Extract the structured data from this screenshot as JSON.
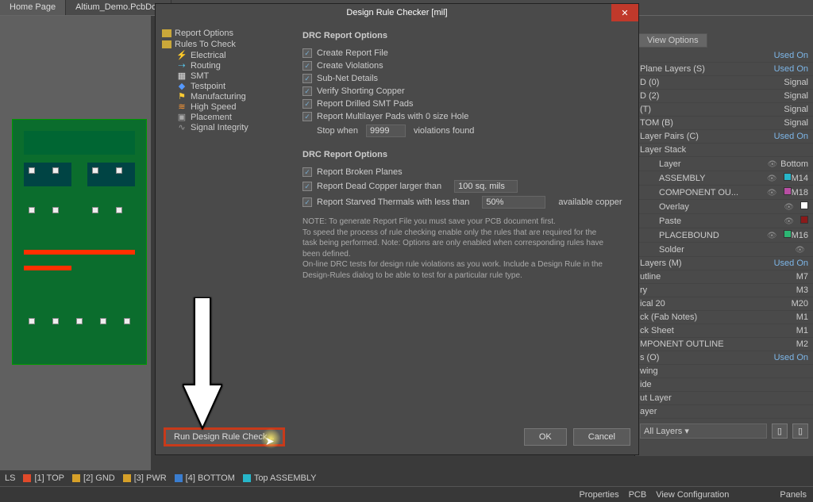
{
  "tabs": {
    "home": "Home Page",
    "doc": "Altium_Demo.PcbDoc"
  },
  "dialog": {
    "title": "Design Rule Checker [mil]",
    "tree": {
      "reportOptions": "Report Options",
      "rulesToCheck": "Rules To Check",
      "children": {
        "electrical": "Electrical",
        "routing": "Routing",
        "smt": "SMT",
        "testpoint": "Testpoint",
        "manufacturing": "Manufacturing",
        "highspeed": "High Speed",
        "placement": "Placement",
        "signalIntegrity": "Signal Integrity"
      }
    },
    "section1": "DRC Report Options",
    "opts": {
      "createReportFile": "Create Report File",
      "createViolations": "Create Violations",
      "subNetDetails": "Sub-Net Details",
      "verifyShortingCopper": "Verify Shorting Copper",
      "reportDrilledSMT": "Report Drilled SMT Pads",
      "reportMultilayer": "Report Multilayer Pads with 0 size Hole",
      "stopWhen": "Stop when",
      "stopValue": "9999",
      "violationsFound": "violations found"
    },
    "section2": "DRC Report Options",
    "opts2": {
      "reportBroken": "Report Broken Planes",
      "reportDead": "Report Dead Copper larger than",
      "deadValue": "100 sq. mils",
      "reportStarved": "Report Starved Thermals with less than",
      "starvedValue": "50%",
      "availableCopper": "available copper"
    },
    "note": "NOTE: To generate Report File you must save your PCB document first.\nTo speed the process of rule checking enable only the rules that are required for the task being performed.  Note: Options are only enabled when corresponding rules have been defined.\nOn-line DRC tests for design rule violations as you work. Include a Design Rule in the Design-Rules dialog to be able to test for a particular rule  type.",
    "runBtn": "Run Design Rule Check...",
    "ok": "OK",
    "cancel": "Cancel"
  },
  "rightPanel": {
    "viewOptions": "View Options",
    "usedOn": "Used On",
    "groups": {
      "planeLayers": "Plane Layers (S)",
      "d0": "D (0)",
      "d2": "D (2)",
      "t": "(T)",
      "tomB": "TOM (B)",
      "layerPairs": "Layer Pairs (C)",
      "layerStack": "Layer Stack"
    },
    "stackHead": {
      "layer": "Layer",
      "bottom": "Bottom"
    },
    "stack": [
      {
        "name": "ASSEMBLY",
        "m": "M14",
        "color": "#27b6c9"
      },
      {
        "name": "COMPONENT OU...",
        "m": "M18",
        "color": "#b84ea3"
      },
      {
        "name": "Overlay",
        "m": "",
        "color": "#ffffff"
      },
      {
        "name": "Paste",
        "m": "",
        "color": "#8a1a1a"
      },
      {
        "name": "PLACEBOUND",
        "m": "M16",
        "color": "#2cb673"
      },
      {
        "name": "Solder",
        "m": "",
        "color": ""
      }
    ],
    "layersM": "Layers (M)",
    "misc": [
      {
        "name": "utline",
        "m": "M7"
      },
      {
        "name": "ry",
        "m": "M3"
      },
      {
        "name": "ical 20",
        "m": "M20"
      },
      {
        "name": "ck (Fab Notes)",
        "m": "M1"
      },
      {
        "name": "ck Sheet",
        "m": "M1"
      },
      {
        "name": "MPONENT OUTLINE",
        "m": "M2"
      }
    ],
    "sO": "s (O)",
    "extras": [
      "wing",
      "ide",
      "ut Layer",
      "ayer"
    ],
    "allLayers": "All Layers",
    "signal": "Signal"
  },
  "layerTabs": {
    "ls": "LS",
    "top": "[1] TOP",
    "gnd": "[2] GND",
    "pwr": "[3] PWR",
    "bottom": "[4] BOTTOM",
    "topAsm": "Top ASSEMBLY"
  },
  "statusbar": {
    "properties": "Properties",
    "pcb": "PCB",
    "viewConfig": "View Configuration",
    "panels": "Panels"
  }
}
